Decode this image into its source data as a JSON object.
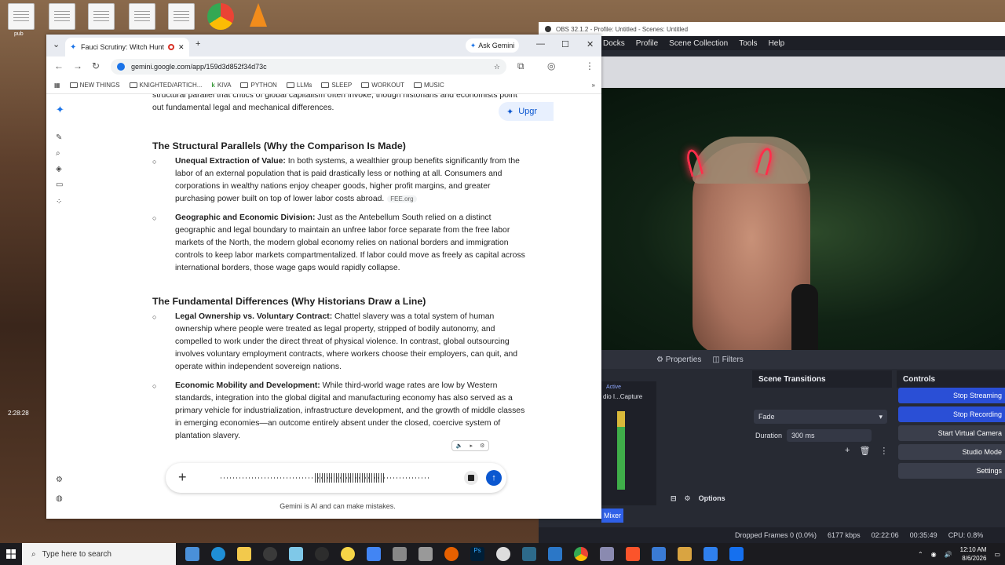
{
  "desktop": {
    "side_labels": [
      "pub",
      "2:28:28"
    ]
  },
  "obs": {
    "title": "OBS 32.1.2 - Profile: Untitled - Scenes: Untitled",
    "menu": [
      "Docks",
      "Profile",
      "Scene Collection",
      "Tools",
      "Help"
    ],
    "properties_label": "Properties",
    "filters_label": "Filters",
    "audio_active": "Active",
    "audio_source": "dio I...Capture",
    "scene_transitions_title": "Scene Transitions",
    "transition_value": "Fade",
    "duration_label": "Duration",
    "duration_value": "300 ms",
    "controls_title": "Controls",
    "controls": [
      "Stop Streaming",
      "Stop Recording",
      "Start Virtual Camera",
      "Studio Mode",
      "Settings"
    ],
    "mixer_tab": "Mixer",
    "options_label": "Options",
    "status": {
      "dropped": "Dropped Frames 0 (0.0%)",
      "bitrate": "6177 kbps",
      "stream_time": "02:22:06",
      "rec_time": "00:35:49",
      "cpu": "CPU: 0.8%"
    }
  },
  "chrome": {
    "tab_title": "Fauci Scrutiny: Witch Hunt",
    "ask_gemini": "Ask Gemini",
    "url": "gemini.google.com/app/159d3d852f34d73c",
    "bookmarks": [
      "NEW THINGS",
      "KNIGHTED/ARTICH...",
      "KIVA",
      "PYTHON",
      "LLMs",
      "SLEEP",
      "WORKOUT",
      "MUSIC"
    ],
    "upgrade_label": "Upgr"
  },
  "article": {
    "lead": "structural parallel that critics of global capitalism often invoke, though historians and economists point out fundamental legal and mechanical differences.",
    "sections": [
      {
        "heading": "The Structural Parallels (Why the Comparison Is Made)",
        "items": [
          {
            "term": "Unequal Extraction of Value:",
            "text": " In both systems, a wealthier group benefits significantly from the labor of an external population that is paid drastically less or nothing at all. Consumers and corporations in wealthy nations enjoy cheaper goods, higher profit margins, and greater purchasing power built on top of lower labor costs abroad.",
            "source": "FEE.org"
          },
          {
            "term": "Geographic and Economic Division:",
            "text": " Just as the Antebellum South relied on a distinct geographic and legal boundary to maintain an unfree labor force separate from the free labor markets of the North, the modern global economy relies on national borders and immigration controls to keep labor markets compartmentalized. If labor could move as freely as capital across international borders, those wage gaps would rapidly collapse.",
            "source": ""
          }
        ]
      },
      {
        "heading": "The Fundamental Differences (Why Historians Draw a Line)",
        "items": [
          {
            "term": "Legal Ownership vs. Voluntary Contract:",
            "text": " Chattel slavery was a total system of human ownership where people were treated as legal property, stripped of bodily autonomy, and compelled to work under the direct threat of physical violence. In contrast, global outsourcing involves voluntary employment contracts, where workers choose their employers, can quit, and operate within independent sovereign nations.",
            "source": ""
          },
          {
            "term": "Economic Mobility and Development:",
            "text": " While third-world wage rates are low by Western standards, integration into the global digital and manufacturing economy has also served as a primary vehicle for industrialization, infrastructure development, and the growth of middle classes in emerging economies—an outcome entirely absent under the closed, coercive system of plantation slavery.",
            "source": ""
          }
        ]
      }
    ],
    "disclaimer": "Gemini is AI and can make mistakes."
  },
  "taskbar": {
    "search_placeholder": "Type here to search",
    "time": "12:10 AM",
    "date": "8/6/2026"
  },
  "colors": {
    "accent": "#0b57d0",
    "obs_blue": "#2a4fd6",
    "horn_red": "#ff2e4a"
  }
}
